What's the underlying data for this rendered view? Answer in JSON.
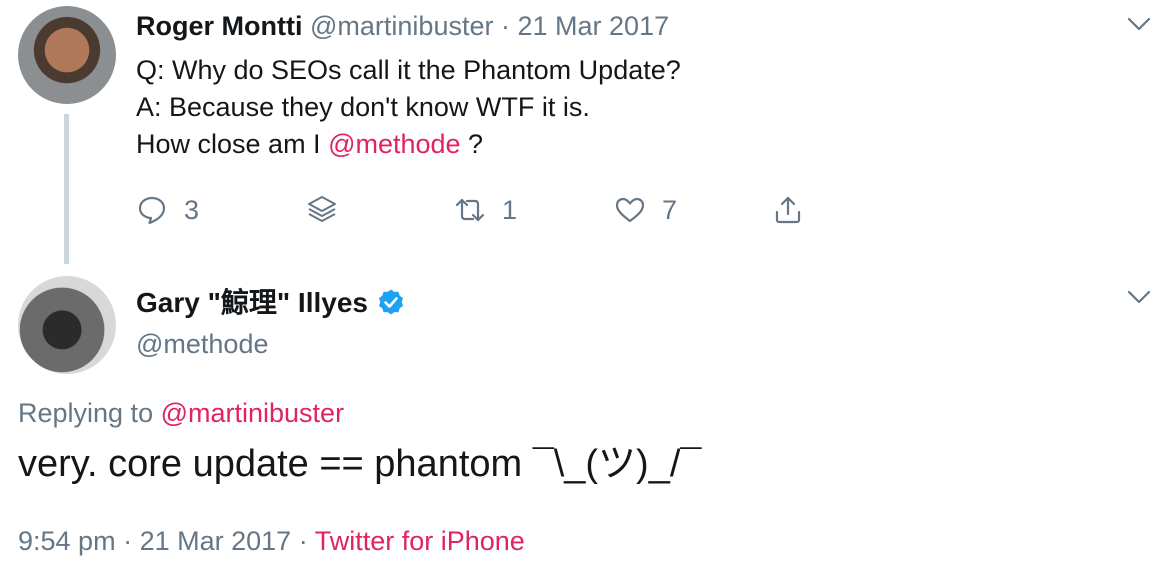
{
  "tweet1": {
    "author_name": "Roger Montti",
    "handle": "@martinibuster",
    "date": "21 Mar 2017",
    "separator": "·",
    "lines": [
      "Q: Why do SEOs call it the Phantom Update?",
      "A: Because they don't know WTF it is."
    ],
    "line3_prefix": "How close am I ",
    "line3_mention": "@methode",
    "line3_suffix": " ?",
    "actions": {
      "reply_count": "3",
      "retweet_count": "1",
      "like_count": "7"
    },
    "icons": [
      "reply-icon",
      "layers-icon",
      "retweet-icon",
      "like-icon",
      "share-icon",
      "chevron-down-icon"
    ]
  },
  "tweet2": {
    "author_name": "Gary \"鯨理\" Illyes",
    "handle": "@methode",
    "replying_prefix": "Replying to ",
    "replying_handle": "@martinibuster",
    "body": "very. core update == phantom ¯\\_(ツ)_/¯",
    "time": "9:54 pm",
    "date": "21 Mar 2017",
    "separator": "·",
    "source": "Twitter for iPhone",
    "icons": [
      "verified-badge-icon",
      "chevron-down-icon"
    ]
  },
  "colors": {
    "accent_mention": "#e0245e",
    "muted_text": "#657786",
    "verified_blue": "#1da1f2",
    "thread_line": "#ccd6dd"
  }
}
